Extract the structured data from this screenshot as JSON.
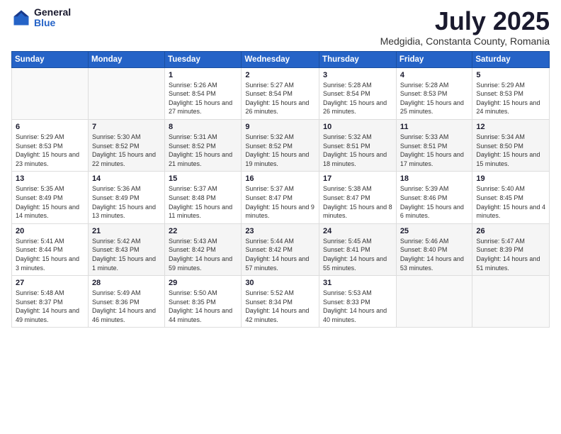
{
  "logo": {
    "general": "General",
    "blue": "Blue"
  },
  "title": "July 2025",
  "subtitle": "Medgidia, Constanta County, Romania",
  "headers": [
    "Sunday",
    "Monday",
    "Tuesday",
    "Wednesday",
    "Thursday",
    "Friday",
    "Saturday"
  ],
  "weeks": [
    [
      {
        "day": "",
        "sunrise": "",
        "sunset": "",
        "daylight": ""
      },
      {
        "day": "",
        "sunrise": "",
        "sunset": "",
        "daylight": ""
      },
      {
        "day": "1",
        "sunrise": "Sunrise: 5:26 AM",
        "sunset": "Sunset: 8:54 PM",
        "daylight": "Daylight: 15 hours and 27 minutes."
      },
      {
        "day": "2",
        "sunrise": "Sunrise: 5:27 AM",
        "sunset": "Sunset: 8:54 PM",
        "daylight": "Daylight: 15 hours and 26 minutes."
      },
      {
        "day": "3",
        "sunrise": "Sunrise: 5:28 AM",
        "sunset": "Sunset: 8:54 PM",
        "daylight": "Daylight: 15 hours and 26 minutes."
      },
      {
        "day": "4",
        "sunrise": "Sunrise: 5:28 AM",
        "sunset": "Sunset: 8:53 PM",
        "daylight": "Daylight: 15 hours and 25 minutes."
      },
      {
        "day": "5",
        "sunrise": "Sunrise: 5:29 AM",
        "sunset": "Sunset: 8:53 PM",
        "daylight": "Daylight: 15 hours and 24 minutes."
      }
    ],
    [
      {
        "day": "6",
        "sunrise": "Sunrise: 5:29 AM",
        "sunset": "Sunset: 8:53 PM",
        "daylight": "Daylight: 15 hours and 23 minutes."
      },
      {
        "day": "7",
        "sunrise": "Sunrise: 5:30 AM",
        "sunset": "Sunset: 8:52 PM",
        "daylight": "Daylight: 15 hours and 22 minutes."
      },
      {
        "day": "8",
        "sunrise": "Sunrise: 5:31 AM",
        "sunset": "Sunset: 8:52 PM",
        "daylight": "Daylight: 15 hours and 21 minutes."
      },
      {
        "day": "9",
        "sunrise": "Sunrise: 5:32 AM",
        "sunset": "Sunset: 8:52 PM",
        "daylight": "Daylight: 15 hours and 19 minutes."
      },
      {
        "day": "10",
        "sunrise": "Sunrise: 5:32 AM",
        "sunset": "Sunset: 8:51 PM",
        "daylight": "Daylight: 15 hours and 18 minutes."
      },
      {
        "day": "11",
        "sunrise": "Sunrise: 5:33 AM",
        "sunset": "Sunset: 8:51 PM",
        "daylight": "Daylight: 15 hours and 17 minutes."
      },
      {
        "day": "12",
        "sunrise": "Sunrise: 5:34 AM",
        "sunset": "Sunset: 8:50 PM",
        "daylight": "Daylight: 15 hours and 15 minutes."
      }
    ],
    [
      {
        "day": "13",
        "sunrise": "Sunrise: 5:35 AM",
        "sunset": "Sunset: 8:49 PM",
        "daylight": "Daylight: 15 hours and 14 minutes."
      },
      {
        "day": "14",
        "sunrise": "Sunrise: 5:36 AM",
        "sunset": "Sunset: 8:49 PM",
        "daylight": "Daylight: 15 hours and 13 minutes."
      },
      {
        "day": "15",
        "sunrise": "Sunrise: 5:37 AM",
        "sunset": "Sunset: 8:48 PM",
        "daylight": "Daylight: 15 hours and 11 minutes."
      },
      {
        "day": "16",
        "sunrise": "Sunrise: 5:37 AM",
        "sunset": "Sunset: 8:47 PM",
        "daylight": "Daylight: 15 hours and 9 minutes."
      },
      {
        "day": "17",
        "sunrise": "Sunrise: 5:38 AM",
        "sunset": "Sunset: 8:47 PM",
        "daylight": "Daylight: 15 hours and 8 minutes."
      },
      {
        "day": "18",
        "sunrise": "Sunrise: 5:39 AM",
        "sunset": "Sunset: 8:46 PM",
        "daylight": "Daylight: 15 hours and 6 minutes."
      },
      {
        "day": "19",
        "sunrise": "Sunrise: 5:40 AM",
        "sunset": "Sunset: 8:45 PM",
        "daylight": "Daylight: 15 hours and 4 minutes."
      }
    ],
    [
      {
        "day": "20",
        "sunrise": "Sunrise: 5:41 AM",
        "sunset": "Sunset: 8:44 PM",
        "daylight": "Daylight: 15 hours and 3 minutes."
      },
      {
        "day": "21",
        "sunrise": "Sunrise: 5:42 AM",
        "sunset": "Sunset: 8:43 PM",
        "daylight": "Daylight: 15 hours and 1 minute."
      },
      {
        "day": "22",
        "sunrise": "Sunrise: 5:43 AM",
        "sunset": "Sunset: 8:42 PM",
        "daylight": "Daylight: 14 hours and 59 minutes."
      },
      {
        "day": "23",
        "sunrise": "Sunrise: 5:44 AM",
        "sunset": "Sunset: 8:42 PM",
        "daylight": "Daylight: 14 hours and 57 minutes."
      },
      {
        "day": "24",
        "sunrise": "Sunrise: 5:45 AM",
        "sunset": "Sunset: 8:41 PM",
        "daylight": "Daylight: 14 hours and 55 minutes."
      },
      {
        "day": "25",
        "sunrise": "Sunrise: 5:46 AM",
        "sunset": "Sunset: 8:40 PM",
        "daylight": "Daylight: 14 hours and 53 minutes."
      },
      {
        "day": "26",
        "sunrise": "Sunrise: 5:47 AM",
        "sunset": "Sunset: 8:39 PM",
        "daylight": "Daylight: 14 hours and 51 minutes."
      }
    ],
    [
      {
        "day": "27",
        "sunrise": "Sunrise: 5:48 AM",
        "sunset": "Sunset: 8:37 PM",
        "daylight": "Daylight: 14 hours and 49 minutes."
      },
      {
        "day": "28",
        "sunrise": "Sunrise: 5:49 AM",
        "sunset": "Sunset: 8:36 PM",
        "daylight": "Daylight: 14 hours and 46 minutes."
      },
      {
        "day": "29",
        "sunrise": "Sunrise: 5:50 AM",
        "sunset": "Sunset: 8:35 PM",
        "daylight": "Daylight: 14 hours and 44 minutes."
      },
      {
        "day": "30",
        "sunrise": "Sunrise: 5:52 AM",
        "sunset": "Sunset: 8:34 PM",
        "daylight": "Daylight: 14 hours and 42 minutes."
      },
      {
        "day": "31",
        "sunrise": "Sunrise: 5:53 AM",
        "sunset": "Sunset: 8:33 PM",
        "daylight": "Daylight: 14 hours and 40 minutes."
      },
      {
        "day": "",
        "sunrise": "",
        "sunset": "",
        "daylight": ""
      },
      {
        "day": "",
        "sunrise": "",
        "sunset": "",
        "daylight": ""
      }
    ]
  ]
}
